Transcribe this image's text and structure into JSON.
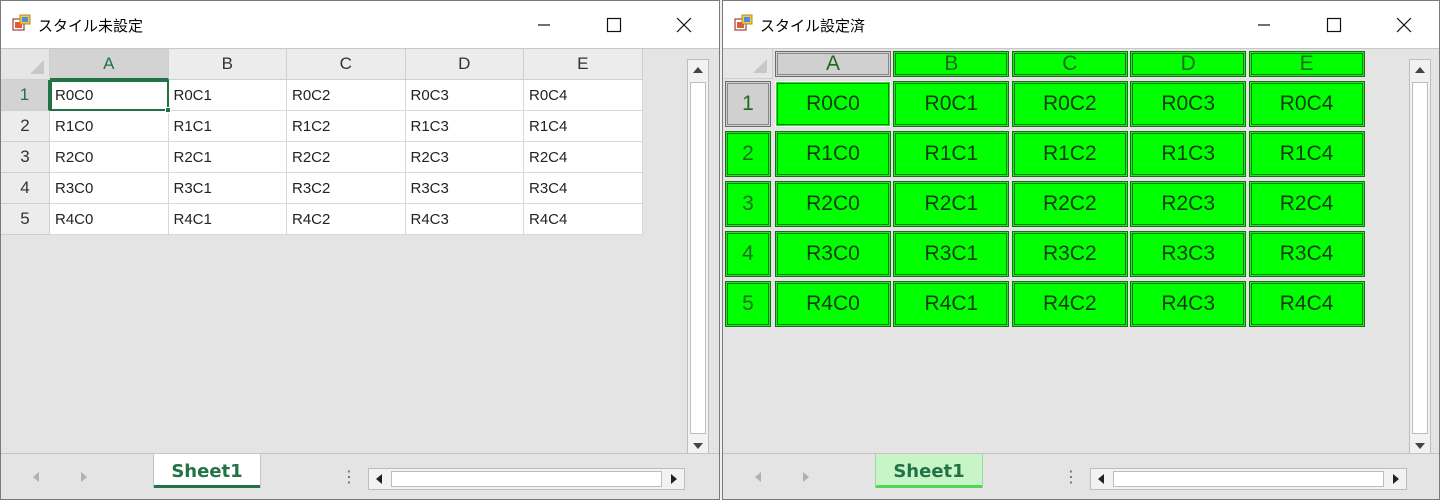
{
  "left_window": {
    "title": "スタイル未設定",
    "columns": [
      "A",
      "B",
      "C",
      "D",
      "E"
    ],
    "rows": [
      "1",
      "2",
      "3",
      "4",
      "5"
    ],
    "cells": [
      [
        "R0C0",
        "R0C1",
        "R0C2",
        "R0C3",
        "R0C4"
      ],
      [
        "R1C0",
        "R1C1",
        "R1C2",
        "R1C3",
        "R1C4"
      ],
      [
        "R2C0",
        "R2C1",
        "R2C2",
        "R2C3",
        "R2C4"
      ],
      [
        "R3C0",
        "R3C1",
        "R3C2",
        "R3C3",
        "R3C4"
      ],
      [
        "R4C0",
        "R4C1",
        "R4C2",
        "R4C3",
        "R4C4"
      ]
    ],
    "active_cell": "A1",
    "sheet_tab": "Sheet1"
  },
  "right_window": {
    "title": "スタイル設定済",
    "columns": [
      "A",
      "B",
      "C",
      "D",
      "E"
    ],
    "rows": [
      "1",
      "2",
      "3",
      "4",
      "5"
    ],
    "cells": [
      [
        "R0C0",
        "R0C1",
        "R0C2",
        "R0C3",
        "R0C4"
      ],
      [
        "R1C0",
        "R1C1",
        "R1C2",
        "R1C3",
        "R1C4"
      ],
      [
        "R2C0",
        "R2C1",
        "R2C2",
        "R2C3",
        "R2C4"
      ],
      [
        "R3C0",
        "R3C1",
        "R3C2",
        "R3C3",
        "R3C4"
      ],
      [
        "R4C0",
        "R4C1",
        "R4C2",
        "R4C3",
        "R4C4"
      ]
    ],
    "active_cell": "A1",
    "sheet_tab": "Sheet1",
    "cell_fill_color": "#00ff00",
    "cell_border_color": "#1a6b1a"
  },
  "colors": {
    "selection_accent": "#217346",
    "header_background": "#ececec",
    "grid_background": "#e4e4e4"
  },
  "icons": [
    "app-icon",
    "minimize-icon",
    "maximize-icon",
    "close-icon",
    "scroll-up-icon",
    "scroll-down-icon",
    "scroll-left-icon",
    "scroll-right-icon",
    "tab-nav-prev-icon",
    "tab-nav-next-icon",
    "tab-split-icon"
  ]
}
